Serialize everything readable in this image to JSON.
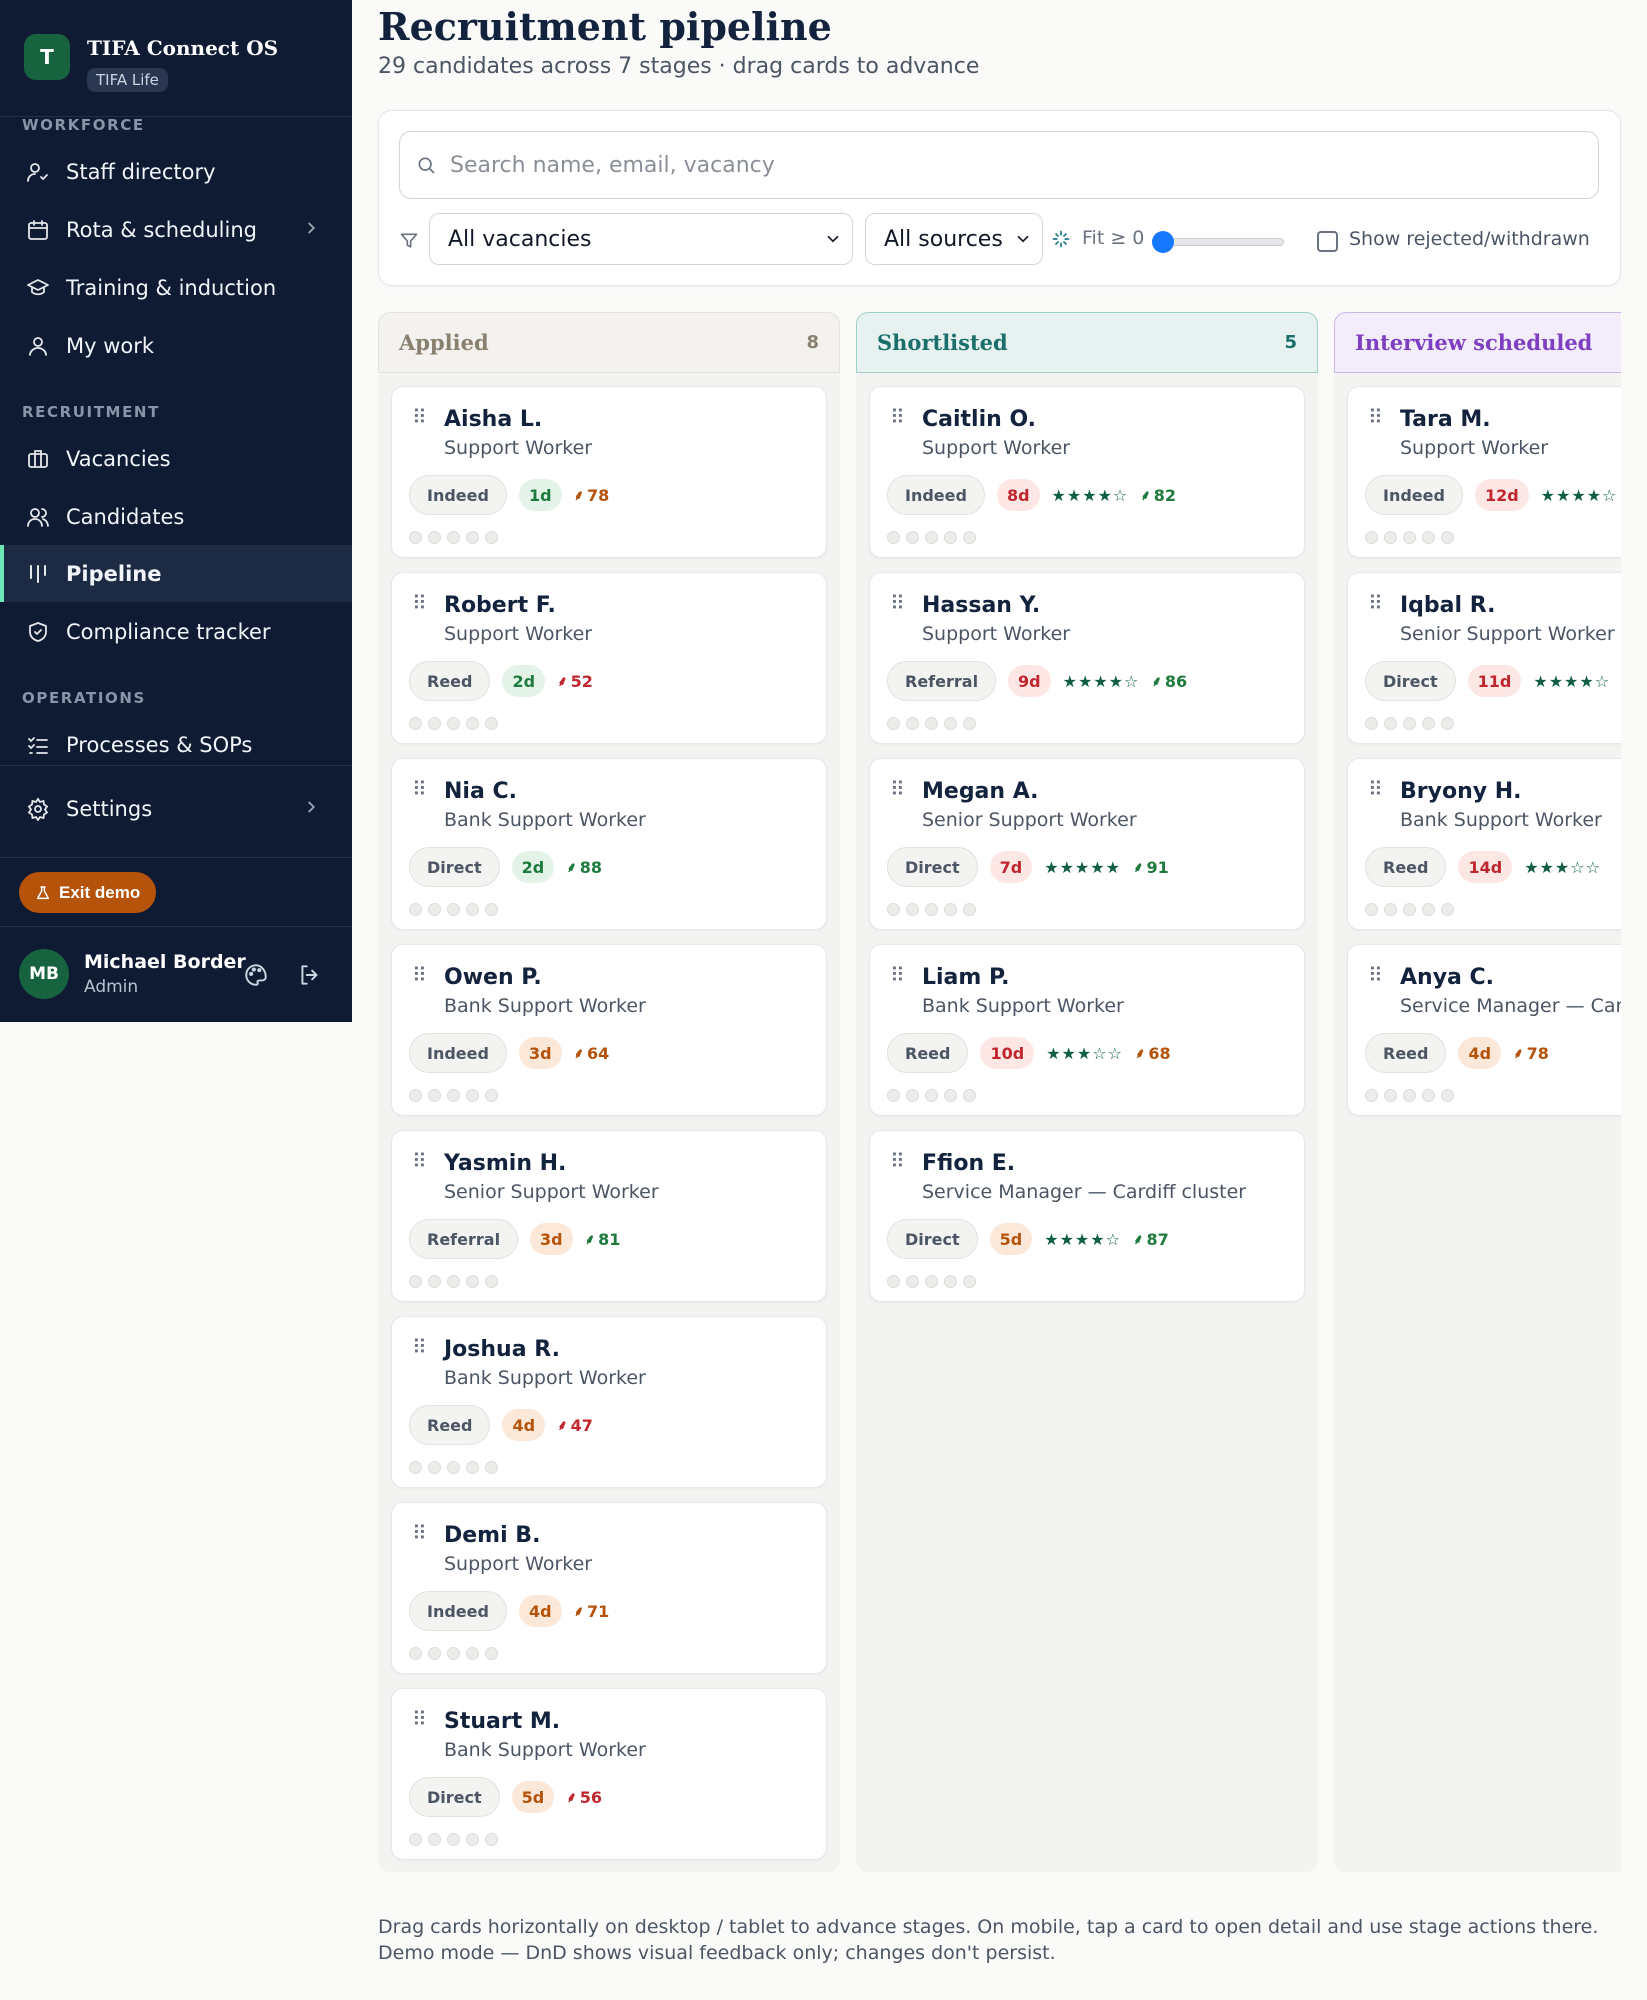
{
  "app": {
    "logo_letter": "T",
    "name": "TIFA Connect OS",
    "org": "TIFA Life"
  },
  "sidebar": {
    "sections": [
      {
        "label": "WORKFORCE"
      },
      {
        "label": "RECRUITMENT"
      },
      {
        "label": "OPERATIONS"
      }
    ],
    "items": [
      {
        "label": "Staff directory",
        "icon": "user-check-icon"
      },
      {
        "label": "Rota & scheduling",
        "icon": "calendar-icon",
        "has_chevron": true
      },
      {
        "label": "Training & induction",
        "icon": "graduation-cap-icon"
      },
      {
        "label": "My work",
        "icon": "user-icon"
      },
      {
        "label": "Vacancies",
        "icon": "briefcase-icon"
      },
      {
        "label": "Candidates",
        "icon": "users-icon"
      },
      {
        "label": "Pipeline",
        "icon": "kanban-icon",
        "active": true
      },
      {
        "label": "Compliance tracker",
        "icon": "shield-check-icon"
      },
      {
        "label": "Processes & SOPs",
        "icon": "list-checks-icon"
      },
      {
        "label": "Settings",
        "icon": "gear-icon",
        "has_chevron": true
      }
    ],
    "exit_demo": "Exit demo",
    "user": {
      "initials": "MB",
      "name": "Michael Border",
      "role": "Admin"
    }
  },
  "header": {
    "title": "Recruitment pipeline",
    "subtitle": "29 candidates across 7 stages · drag cards to advance"
  },
  "filters": {
    "search_placeholder": "Search name, email, vacancy",
    "vacancy_select": "All vacancies",
    "source_select": "All sources",
    "fit_label": "Fit ≥ 0",
    "fit_value": 0,
    "show_rejected_label": "Show rejected/withdrawn",
    "show_rejected_checked": false
  },
  "columns": [
    {
      "title": "Applied",
      "count": "8",
      "colors": {
        "bg": "#f3f2ee",
        "border": "#e5e3dc",
        "text": "#8a8070"
      },
      "cards": [
        {
          "name": "Aisha L.",
          "role": "Support Worker",
          "source": "Indeed",
          "age": "1d",
          "age_tone": "green",
          "stars": "",
          "fit": "78",
          "fit_tone": "orange"
        },
        {
          "name": "Robert F.",
          "role": "Support Worker",
          "source": "Reed",
          "age": "2d",
          "age_tone": "green",
          "stars": "",
          "fit": "52",
          "fit_tone": "red"
        },
        {
          "name": "Nia C.",
          "role": "Bank Support Worker",
          "source": "Direct",
          "age": "2d",
          "age_tone": "green",
          "stars": "",
          "fit": "88",
          "fit_tone": "green"
        },
        {
          "name": "Owen P.",
          "role": "Bank Support Worker",
          "source": "Indeed",
          "age": "3d",
          "age_tone": "orange",
          "stars": "",
          "fit": "64",
          "fit_tone": "orange"
        },
        {
          "name": "Yasmin H.",
          "role": "Senior Support Worker",
          "source": "Referral",
          "age": "3d",
          "age_tone": "orange",
          "stars": "",
          "fit": "81",
          "fit_tone": "green"
        },
        {
          "name": "Joshua R.",
          "role": "Bank Support Worker",
          "source": "Reed",
          "age": "4d",
          "age_tone": "orange",
          "stars": "",
          "fit": "47",
          "fit_tone": "red"
        },
        {
          "name": "Demi B.",
          "role": "Support Worker",
          "source": "Indeed",
          "age": "4d",
          "age_tone": "orange",
          "stars": "",
          "fit": "71",
          "fit_tone": "orange"
        },
        {
          "name": "Stuart M.",
          "role": "Bank Support Worker",
          "source": "Direct",
          "age": "5d",
          "age_tone": "orange",
          "stars": "",
          "fit": "56",
          "fit_tone": "red"
        }
      ]
    },
    {
      "title": "Shortlisted",
      "count": "5",
      "colors": {
        "bg": "#e6f1f0",
        "border": "#9fcfc9",
        "text": "#1b6f6a"
      },
      "cards": [
        {
          "name": "Caitlin O.",
          "role": "Support Worker",
          "source": "Indeed",
          "age": "8d",
          "age_tone": "red",
          "stars": "★★★★☆",
          "fit": "82",
          "fit_tone": "green"
        },
        {
          "name": "Hassan Y.",
          "role": "Support Worker",
          "source": "Referral",
          "age": "9d",
          "age_tone": "red",
          "stars": "★★★★☆",
          "fit": "86",
          "fit_tone": "green"
        },
        {
          "name": "Megan A.",
          "role": "Senior Support Worker",
          "source": "Direct",
          "age": "7d",
          "age_tone": "red",
          "stars": "★★★★★",
          "fit": "91",
          "fit_tone": "green"
        },
        {
          "name": "Liam P.",
          "role": "Bank Support Worker",
          "source": "Reed",
          "age": "10d",
          "age_tone": "red",
          "stars": "★★★☆☆",
          "fit": "68",
          "fit_tone": "orange"
        },
        {
          "name": "Ffion E.",
          "role": "Service Manager — Cardiff cluster",
          "source": "Direct",
          "age": "5d",
          "age_tone": "orange",
          "stars": "★★★★☆",
          "fit": "87",
          "fit_tone": "green"
        }
      ]
    },
    {
      "title": "Interview scheduled",
      "count": "",
      "colors": {
        "bg": "#f3ecfb",
        "border": "#cdb6ee",
        "text": "#7e3fc2"
      },
      "cards": [
        {
          "name": "Tara M.",
          "role": "Support Worker",
          "source": "Indeed",
          "age": "12d",
          "age_tone": "red",
          "stars": "★★★★☆",
          "fit": "",
          "fit_tone": "green"
        },
        {
          "name": "Iqbal R.",
          "role": "Senior Support Worker",
          "source": "Direct",
          "age": "11d",
          "age_tone": "red",
          "stars": "★★★★☆",
          "fit": "",
          "fit_tone": "green"
        },
        {
          "name": "Bryony H.",
          "role": "Bank Support Worker",
          "source": "Reed",
          "age": "14d",
          "age_tone": "red",
          "stars": "★★★☆☆",
          "fit": "",
          "fit_tone": "orange"
        },
        {
          "name": "Anya C.",
          "role": "Service Manager — Car",
          "source": "Reed",
          "age": "4d",
          "age_tone": "orange",
          "stars": "",
          "fit": "78",
          "fit_tone": "orange"
        }
      ]
    }
  ],
  "tone_colors": {
    "green": {
      "bg": "#e3f3e8",
      "fg": "#1f7a3e"
    },
    "orange": {
      "bg": "#fbe8d8",
      "fg": "#b45309"
    },
    "red": {
      "bg": "#fde7e5",
      "fg": "#c0262d"
    }
  },
  "footer_note": "Drag cards horizontally on desktop / tablet to advance stages. On mobile, tap a card to open detail and use stage actions there. Demo mode — DnD shows visual feedback only; changes don't persist."
}
